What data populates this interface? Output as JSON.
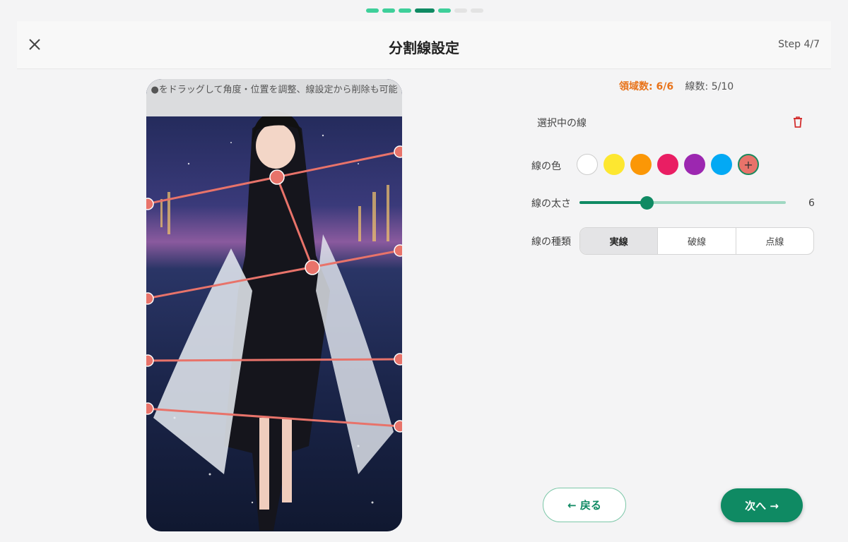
{
  "progress": {
    "total": 7,
    "current": 4
  },
  "header": {
    "title": "分割線設定",
    "step": "Step 4/7"
  },
  "canvas": {
    "hint": "●をドラッグして角度・位置を調整、線設定から削除も可能",
    "line_color": "#e8736a"
  },
  "stats": {
    "regions": "領域数: 6/6",
    "lines": "線数: 5/10"
  },
  "panel": {
    "selected_line_label": "選択中の線",
    "color_label": "線の色",
    "colors": [
      "#ffffff",
      "#fde730",
      "#fb9706",
      "#e91e63",
      "#9c27b0",
      "#03a9f4",
      "#e8736a"
    ],
    "add_color_label": "+",
    "width_label": "線の太さ",
    "width_value": "6",
    "width_fraction": 0.33,
    "type_label": "線の種類",
    "types": [
      "実線",
      "破線",
      "点線"
    ],
    "selected_type": "実線"
  },
  "nav": {
    "back_label": "← 戻る",
    "next_label": "次へ →"
  }
}
